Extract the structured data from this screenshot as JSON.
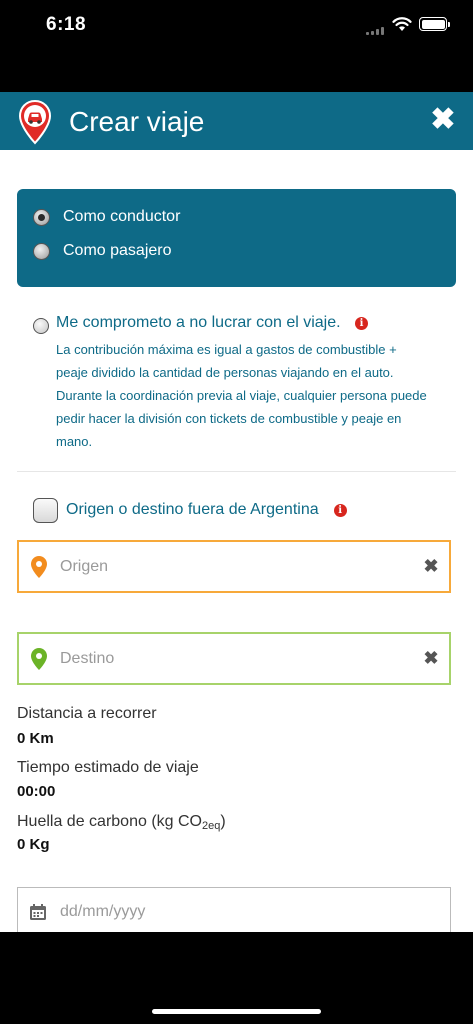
{
  "status_bar": {
    "time": "6:18"
  },
  "header": {
    "title": "Crear viaje",
    "close_label": "✖"
  },
  "role": {
    "options": [
      {
        "label": "Como conductor",
        "selected": true
      },
      {
        "label": "Como pasajero",
        "selected": false
      }
    ]
  },
  "commitment": {
    "title": "Me comprometo a no lucrar con el viaje.",
    "info_glyph": "i",
    "description": "La contribución máxima es igual a gastos de combustible + peaje dividido la cantidad de personas viajando en el auto. Durante la coordinación previa al viaje, cualquier persona puede pedir hacer la división con tickets de combustible y peaje en mano."
  },
  "abroad": {
    "label": "Origen o destino fuera de Argentina",
    "info_glyph": "i",
    "checked": false
  },
  "origin": {
    "placeholder": "Origen",
    "clear_label": "✖",
    "pin_color": "#f28c1e"
  },
  "destination": {
    "placeholder": "Destino",
    "clear_label": "✖",
    "pin_color": "#6bb327"
  },
  "stats": {
    "distance_label": "Distancia a recorrer",
    "distance_value": "0 Km",
    "time_label": "Tiempo estimado de viaje",
    "time_value": "00:00",
    "carbon_label_main": "Huella de carbono (kg CO",
    "carbon_label_sub": "2eq",
    "carbon_label_end": ")",
    "carbon_value": "0 Kg"
  },
  "date": {
    "placeholder": "dd/mm/yyyy"
  },
  "colors": {
    "brand": "#0e6a87",
    "info": "#d7261e",
    "origin_border": "#f7a93a",
    "destination_border": "#a7d36a"
  }
}
